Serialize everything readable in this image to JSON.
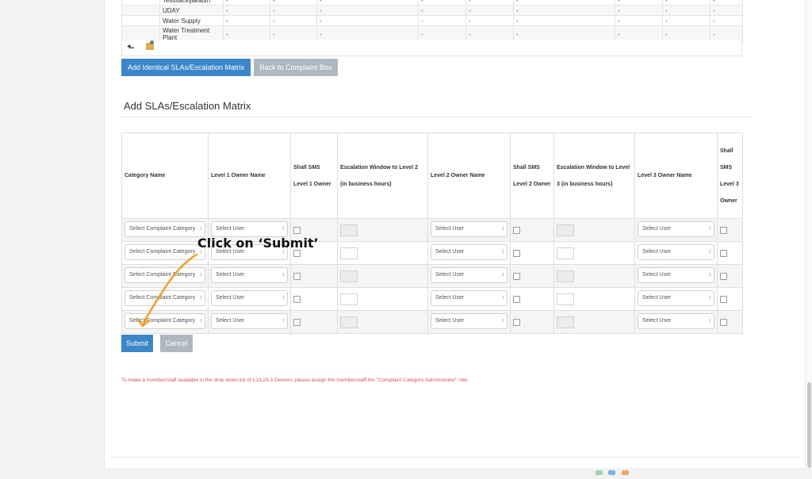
{
  "top_table": {
    "rows": [
      {
        "name": "Testisackijakadin",
        "cells": [
          "-",
          "-",
          "-",
          "-",
          "-",
          "-",
          "-",
          "-",
          "-"
        ]
      },
      {
        "name": "UDAY",
        "cells": [
          "-",
          "-",
          "-",
          "-",
          "-",
          "-",
          "-",
          "-",
          "-"
        ]
      },
      {
        "name": "Water Supply",
        "cells": [
          "-",
          "-",
          "-",
          "-",
          "-",
          "-",
          "-",
          "-",
          "-"
        ]
      },
      {
        "name": "Water Treatment Plant",
        "cells": [
          "-",
          "-",
          "-",
          "-",
          "-",
          "-",
          "-",
          "-",
          "-"
        ]
      }
    ]
  },
  "actions": {
    "add_identical": "Add Identical SLAs/Escalation Matrix",
    "back": "Back to Complaint Box"
  },
  "section": {
    "title": "Add SLAs/Escalation Matrix"
  },
  "matrix": {
    "headers": [
      "Category Name",
      "Level 1 Owner Name",
      "Shall SMS Level 1 Owner",
      "Escalation Window to Level 2 (in business hours)",
      "Level 2 Owner Name",
      "Shall SMS Level 2 Owner",
      "Escalation Window to Level 3 (in business hours)",
      "Level 3 Owner Name",
      "Shall SMS Level 3 Owner"
    ],
    "category_placeholder": "Select Complaint Category",
    "user_placeholder": "Select User",
    "rows": [
      {
        "window_enabled": false
      },
      {
        "window_enabled": true
      },
      {
        "window_enabled": false
      },
      {
        "window_enabled": true
      },
      {
        "window_enabled": false
      }
    ]
  },
  "form_buttons": {
    "submit": "Submit",
    "cancel": "Cancel"
  },
  "annotation": {
    "text": "Click on ‘Submit’",
    "color": "#f0a030"
  },
  "note": "To make a member/staff available in the drop down list of L1/L2/L3 Owners, please assign the member/staff the \"Complaint Category Administrator\" role.",
  "colors": {
    "primary": "#3b86c8",
    "secondary": "#aeb8c1",
    "note": "#d9534f"
  }
}
